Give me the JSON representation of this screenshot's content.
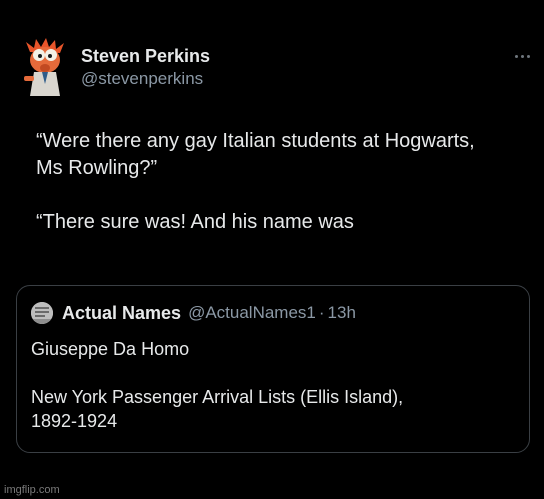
{
  "tweet": {
    "author": {
      "display_name": "Steven Perkins",
      "handle": "@stevenperkins",
      "avatar_icon": "beaker-muppet-avatar"
    },
    "more_icon": "more-dots-icon",
    "text_lines": [
      "“Were there any gay Italian students at Hogwarts,",
      "Ms Rowling?”",
      "“There sure was! And his name was"
    ]
  },
  "quote": {
    "author": {
      "display_name": "Actual Names",
      "handle": "@ActualNames1",
      "separator": "·",
      "time": "13h",
      "avatar_icon": "actual-names-avatar"
    },
    "body_lines": [
      "Giuseppe Da Homo",
      "New York Passenger Arrival Lists (Ellis Island),",
      "1892-1924"
    ]
  },
  "watermark": "imgflip.com",
  "colors": {
    "background": "#000000",
    "primary_text": "#e7e9ea",
    "secondary_text": "#8b98a5",
    "card_border": "#3a3f44"
  }
}
